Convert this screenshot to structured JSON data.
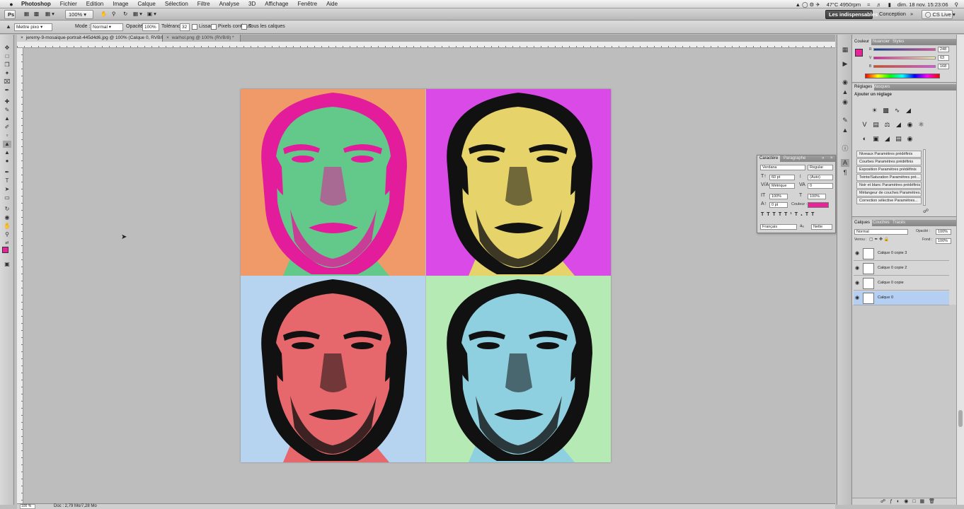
{
  "menubar": {
    "app": "Photoshop",
    "items": [
      "Fichier",
      "Edition",
      "Image",
      "Calque",
      "Sélection",
      "Filtre",
      "Analyse",
      "3D",
      "Affichage",
      "Fenêtre",
      "Aide"
    ],
    "temperature": "47°C 4950rpm",
    "datetime": "dim. 18 nov. 15:23:06"
  },
  "appbar": {
    "zoom": "100%",
    "workspace_active": "Les indispensables",
    "workspace_other": "Conception",
    "cslive": "CS Live"
  },
  "options": {
    "preset": "Mettre pixo",
    "mode_label": "Mode :",
    "mode_value": "Normal",
    "opacity_label": "Opacité :",
    "opacity_value": "100%",
    "tolerance_label": "Tolérance :",
    "tolerance_value": "32",
    "lissage": "Lissage",
    "contigus": "Pixels contigus",
    "tous_calques": "Tous les calques"
  },
  "tabs": [
    {
      "label": "jeremy-9-mosaique-portrait-445d4d6.jpg @ 100% (Calque 0, RVB/8#) *",
      "active": true
    },
    {
      "label": "warhol.png @ 100% (RVB/8) *",
      "active": false
    }
  ],
  "status": {
    "zoom": "100 %",
    "doc": "Doc : 2,79 Mo/7,28 Mo"
  },
  "character": {
    "tab_active": "Caractère",
    "tab_other": "Paragraphe",
    "font_family": "Verdana",
    "font_style": "Regular",
    "size": "60 pt",
    "leading": "(Auto)",
    "kerning": "Métrique",
    "tracking": "0",
    "vscale": "100%",
    "hscale": "100%",
    "baseline": "0 pt",
    "color_label": "Couleur :",
    "color_hex": "#e8239a",
    "language": "Français",
    "aa_label": "aₐ",
    "aa_value": "Nette"
  },
  "color_panel": {
    "tab_active": "Couleur",
    "tab_2": "Nuancier",
    "tab_3": "Styles",
    "r": "248",
    "g": "63",
    "b": "168"
  },
  "adjustments_panel": {
    "tab_active": "Réglages",
    "tab_2": "Masques",
    "title": "Ajouter un réglage",
    "presets": [
      "Niveaux Paramètres prédéfinis",
      "Courbes Paramètres prédéfinis",
      "Exposition Paramètres prédéfinis",
      "Teinte/Saturation Paramètres pré...",
      "Noir et blanc Paramètres prédéfinis",
      "Mélangeur de couches Paramètres...",
      "Correction sélective Paramètres..."
    ]
  },
  "layers_panel": {
    "tab_active": "Calques",
    "tab_2": "Couches",
    "tab_3": "Tracés",
    "blend_mode": "Normal",
    "opacity_label": "Opacité :",
    "opacity_value": "100%",
    "lock_label": "Verrou :",
    "fill_label": "Fond :",
    "fill_value": "100%",
    "layers": [
      {
        "name": "Calque 0 copie 3",
        "selected": false
      },
      {
        "name": "Calque 0 copie 2",
        "selected": false
      },
      {
        "name": "Calque 0 copie",
        "selected": false
      },
      {
        "name": "Calque 0",
        "selected": true
      }
    ]
  },
  "artwork": {
    "quadrants": [
      {
        "name": "top-left",
        "bg": "#ef9a68",
        "face": "#62c98a",
        "ink": "#e21c9a"
      },
      {
        "name": "top-right",
        "bg": "#d94ae6",
        "face": "#e6d36a",
        "ink": "#111111"
      },
      {
        "name": "bottom-left",
        "bg": "#b6d3ef",
        "face": "#e6676c",
        "ink": "#111111"
      },
      {
        "name": "bottom-right",
        "bg": "#b5eab4",
        "face": "#8fd0e0",
        "ink": "#111111"
      }
    ]
  }
}
